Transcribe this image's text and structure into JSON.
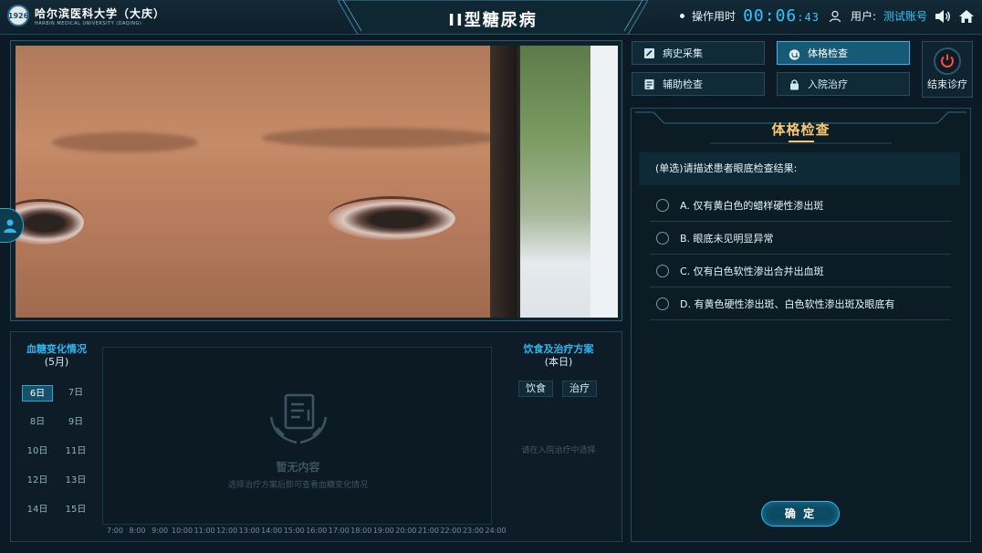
{
  "header": {
    "logo_cn": "哈尔滨医科大学（大庆）",
    "logo_en": "HARBIN MEDICAL UNIVERSITY  (DAQING)",
    "logo_badge": "1926",
    "title": "II型糖尿病",
    "timer_label": "操作用时",
    "timer_value": "00:06",
    "timer_seconds": ":43",
    "user_label": "用户:",
    "user_value": "测试账号"
  },
  "nav": {
    "history": "病史采集",
    "physical": "体格检查",
    "auxiliary": "辅助检查",
    "admission": "入院治疗",
    "end": "结束诊疗",
    "active": "physical"
  },
  "exam": {
    "title": "体格检查",
    "question": "(单选)请描述患者眼底检查结果:",
    "options": [
      "A. 仅有黄白色的蜡样硬性渗出斑",
      "B. 眼底未见明显异常",
      "C. 仅有白色软性渗出合并出血斑",
      "D. 有黄色硬性渗出斑、白色软性渗出斑及眼底有"
    ],
    "confirm": "确 定"
  },
  "blood_sugar": {
    "title": "血糖变化情况",
    "month": "(5月)",
    "days": [
      "6日",
      "7日",
      "8日",
      "9日",
      "10日",
      "11日",
      "12日",
      "13日",
      "14日",
      "15日"
    ],
    "active_day": "6日",
    "empty_title": "暂无内容",
    "empty_hint": "选择治疗方案后即可查看血糖变化情况",
    "x_ticks": [
      "7:00",
      "8:00",
      "9:00",
      "10:00",
      "11:00",
      "12:00",
      "13:00",
      "14:00",
      "15:00",
      "16:00",
      "17:00",
      "18:00",
      "19:00",
      "20:00",
      "21:00",
      "22:00",
      "23:00",
      "24:00"
    ]
  },
  "diet": {
    "title": "饮食及治疗方案",
    "subtitle": "(本日)",
    "tab_diet": "饮食",
    "tab_treatment": "治疗",
    "hint": "请在入院治疗中选择"
  },
  "colors": {
    "accent": "#2fb6ef",
    "title_gold": "#f6c772",
    "background": "#0b1a24"
  }
}
